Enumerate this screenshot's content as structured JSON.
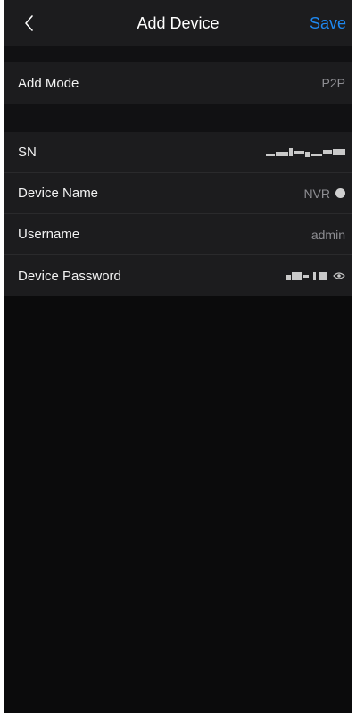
{
  "header": {
    "title": "Add Device",
    "save_label": "Save"
  },
  "sections": [
    {
      "rows": [
        {
          "label": "Add Mode",
          "value": "P2P"
        }
      ]
    },
    {
      "rows": [
        {
          "label": "SN",
          "value_icon": "redacted-serial-number"
        },
        {
          "label": "Device Name",
          "value": "NVR",
          "value_icon": "clear-icon"
        },
        {
          "label": "Username",
          "value": "admin"
        },
        {
          "label": "Device Password",
          "value_icon": "redacted-password",
          "trailing_icon": "eye-icon"
        }
      ]
    }
  ],
  "colors": {
    "accent": "#1e88f0",
    "background": "#0b0b0c",
    "surface": "#1c1c1e"
  }
}
